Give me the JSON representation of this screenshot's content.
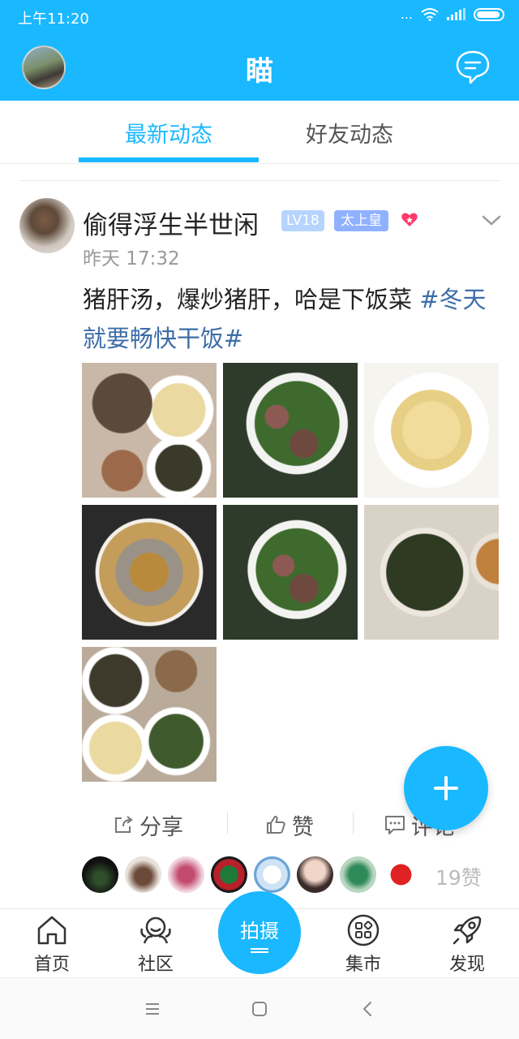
{
  "status_bar": {
    "time": "上午11:20",
    "dots": "...",
    "wifi_icon": "wifi-icon",
    "signal_icon": "signal-icon",
    "battery_icon": "battery-icon"
  },
  "header": {
    "title": "瞄",
    "avatar_icon": "avatar",
    "chat_icon": "chat-bubble-icon"
  },
  "tabs": [
    {
      "label": "最新动态",
      "active": true
    },
    {
      "label": "好友动态",
      "active": false
    }
  ],
  "post": {
    "author": "偷得浮生半世闲",
    "level": "LV18",
    "rank": "太上皇",
    "time": "昨天 17:32",
    "text": "猪肝汤，爆炒猪肝，哈是下饭菜 ",
    "hashtag": "#冬天就要畅快干饭#",
    "photo_count": 7,
    "actions": {
      "share": "分享",
      "like": "赞",
      "comment": "评论"
    },
    "likes_label": "19赞"
  },
  "bottom_nav": {
    "home": "首页",
    "community": "社区",
    "shoot": "拍摄",
    "market": "集市",
    "discover": "发现"
  },
  "colors": {
    "accent": "#1ab8ff",
    "hashtag": "#3d6ea8",
    "level_badge": "#b6d4ff",
    "rank_badge": "#8fb1ff"
  }
}
